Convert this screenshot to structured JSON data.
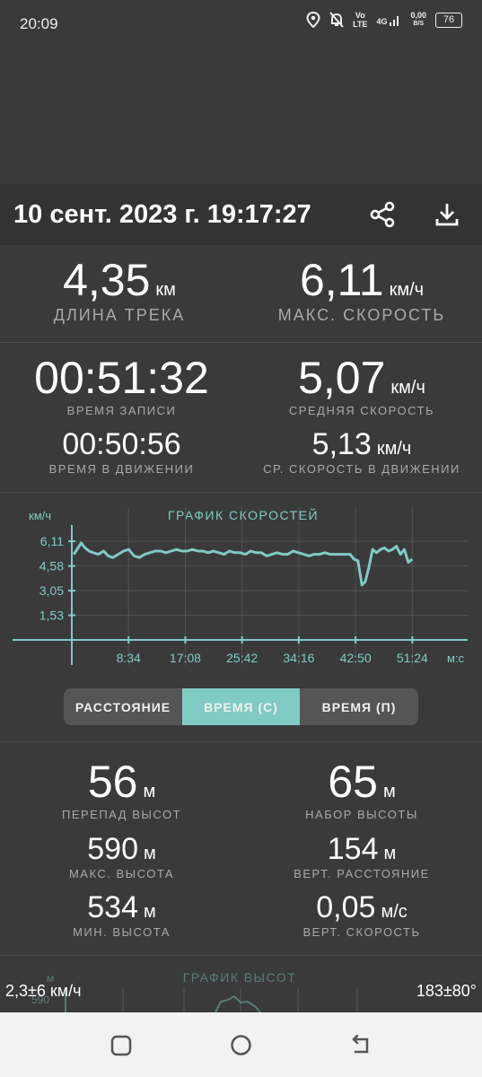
{
  "status_bar": {
    "time": "20:09",
    "volte": "Vo\nLTE",
    "network": "4G",
    "data_rate": "0,00",
    "data_rate_unit": "B/S",
    "battery": "76"
  },
  "header": {
    "title": "10 сент. 2023 г. 19:17:27"
  },
  "track": {
    "length": {
      "value": "4,35",
      "unit": "км",
      "label": "ДЛИНА ТРЕКА"
    },
    "max_speed": {
      "value": "6,11",
      "unit": "км/ч",
      "label": "МАКС. СКОРОСТЬ"
    },
    "record_time": {
      "value": "00:51:32",
      "label": "ВРЕМЯ ЗАПИСИ"
    },
    "avg_speed": {
      "value": "5,07",
      "unit": "км/ч",
      "label": "СРЕДНЯЯ СКОРОСТЬ"
    },
    "moving_time": {
      "value": "00:50:56",
      "label": "ВРЕМЯ В ДВИЖЕНИИ"
    },
    "avg_moving_speed": {
      "value": "5,13",
      "unit": "км/ч",
      "label": "СР. СКОРОСТЬ В ДВИЖЕНИИ"
    }
  },
  "speed_chart_header": {
    "title": "ГРАФИК СКОРОСТЕЙ",
    "y_unit": "км/ч",
    "x_unit": "м:с"
  },
  "chart_data": {
    "type": "line",
    "title": "ГРАФИК СКОРОСТЕЙ",
    "ylabel": "км/ч",
    "xlabel": "м:с",
    "y_ticks": [
      "1,53",
      "3,05",
      "4,58",
      "6,11"
    ],
    "x_ticks": [
      "8:34",
      "17:08",
      "25:42",
      "34:16",
      "42:50",
      "51:24"
    ],
    "ylim": [
      0,
      6.6
    ],
    "xlim": [
      0,
      52
    ],
    "grid": true,
    "series": [
      {
        "x": [
          0.3,
          0.8,
          1.4,
          2.0,
          2.6,
          3.2,
          4.0,
          4.8,
          5.5,
          6.2,
          7.0,
          7.8,
          8.6,
          9.4,
          10.2,
          11.0,
          11.8,
          12.6,
          13.4,
          14.2,
          15.0,
          15.8,
          16.6,
          17.4,
          18.2,
          19.0,
          19.8,
          20.6,
          21.4,
          22.2,
          23.0,
          23.8,
          24.6,
          25.4,
          26.2,
          27.0,
          27.8,
          28.6,
          29.4,
          30.2,
          31.0,
          31.8,
          32.6,
          33.4,
          34.2,
          35.0,
          35.8,
          36.6,
          37.4,
          38.2,
          39.0,
          39.8,
          40.6,
          41.4,
          42.0,
          42.6,
          43.2,
          43.8,
          44.3,
          44.8,
          45.4,
          46.0,
          46.6,
          47.2,
          47.8,
          48.4,
          49.0,
          49.6,
          50.2,
          50.8,
          51.4
        ],
        "y": [
          5.3,
          5.6,
          6.0,
          5.7,
          5.5,
          5.4,
          5.3,
          5.5,
          5.2,
          5.1,
          5.3,
          5.5,
          5.6,
          5.2,
          5.1,
          5.3,
          5.4,
          5.5,
          5.5,
          5.4,
          5.5,
          5.6,
          5.5,
          5.5,
          5.6,
          5.5,
          5.5,
          5.4,
          5.5,
          5.4,
          5.3,
          5.5,
          5.4,
          5.4,
          5.3,
          5.5,
          5.4,
          5.4,
          5.2,
          5.3,
          5.4,
          5.3,
          5.3,
          5.5,
          5.4,
          5.3,
          5.2,
          5.3,
          5.3,
          5.4,
          5.3,
          5.3,
          5.3,
          5.3,
          5.3,
          5.0,
          4.9,
          3.4,
          3.6,
          4.4,
          5.6,
          5.4,
          5.6,
          5.7,
          5.5,
          5.6,
          5.8,
          5.3,
          5.6,
          4.8,
          5.0
        ]
      }
    ]
  },
  "segment": {
    "distance": "РАССТОЯНИЕ",
    "time_c": "ВРЕМЯ (С)",
    "time_p": "ВРЕМЯ (П)"
  },
  "elevation": {
    "diff": {
      "value": "56",
      "unit": "м",
      "label": "ПЕРЕПАД ВЫСОТ"
    },
    "gain": {
      "value": "65",
      "unit": "м",
      "label": "НАБОР ВЫСОТЫ"
    },
    "max": {
      "value": "590",
      "unit": "м",
      "label": "МАКС. ВЫСОТА"
    },
    "vert_dist": {
      "value": "154",
      "unit": "м",
      "label": "ВЕРТ. РАССТОЯНИЕ"
    },
    "min": {
      "value": "534",
      "unit": "м",
      "label": "МИН. ВЫСОТА"
    },
    "vert_speed": {
      "value": "0,05",
      "unit": "м/с",
      "label": "ВЕРТ. СКОРОСТЬ"
    }
  },
  "elev_chart": {
    "title": "ГРАФИК ВЫСОТ",
    "y_unit": "м",
    "y_tick_partial": "590"
  },
  "overlay": {
    "speed": "2,3±6 км/ч",
    "bearing": "183±80°"
  },
  "colors": {
    "accent": "#80cbc4",
    "background": "#3a3a3a",
    "header": "#333333"
  }
}
